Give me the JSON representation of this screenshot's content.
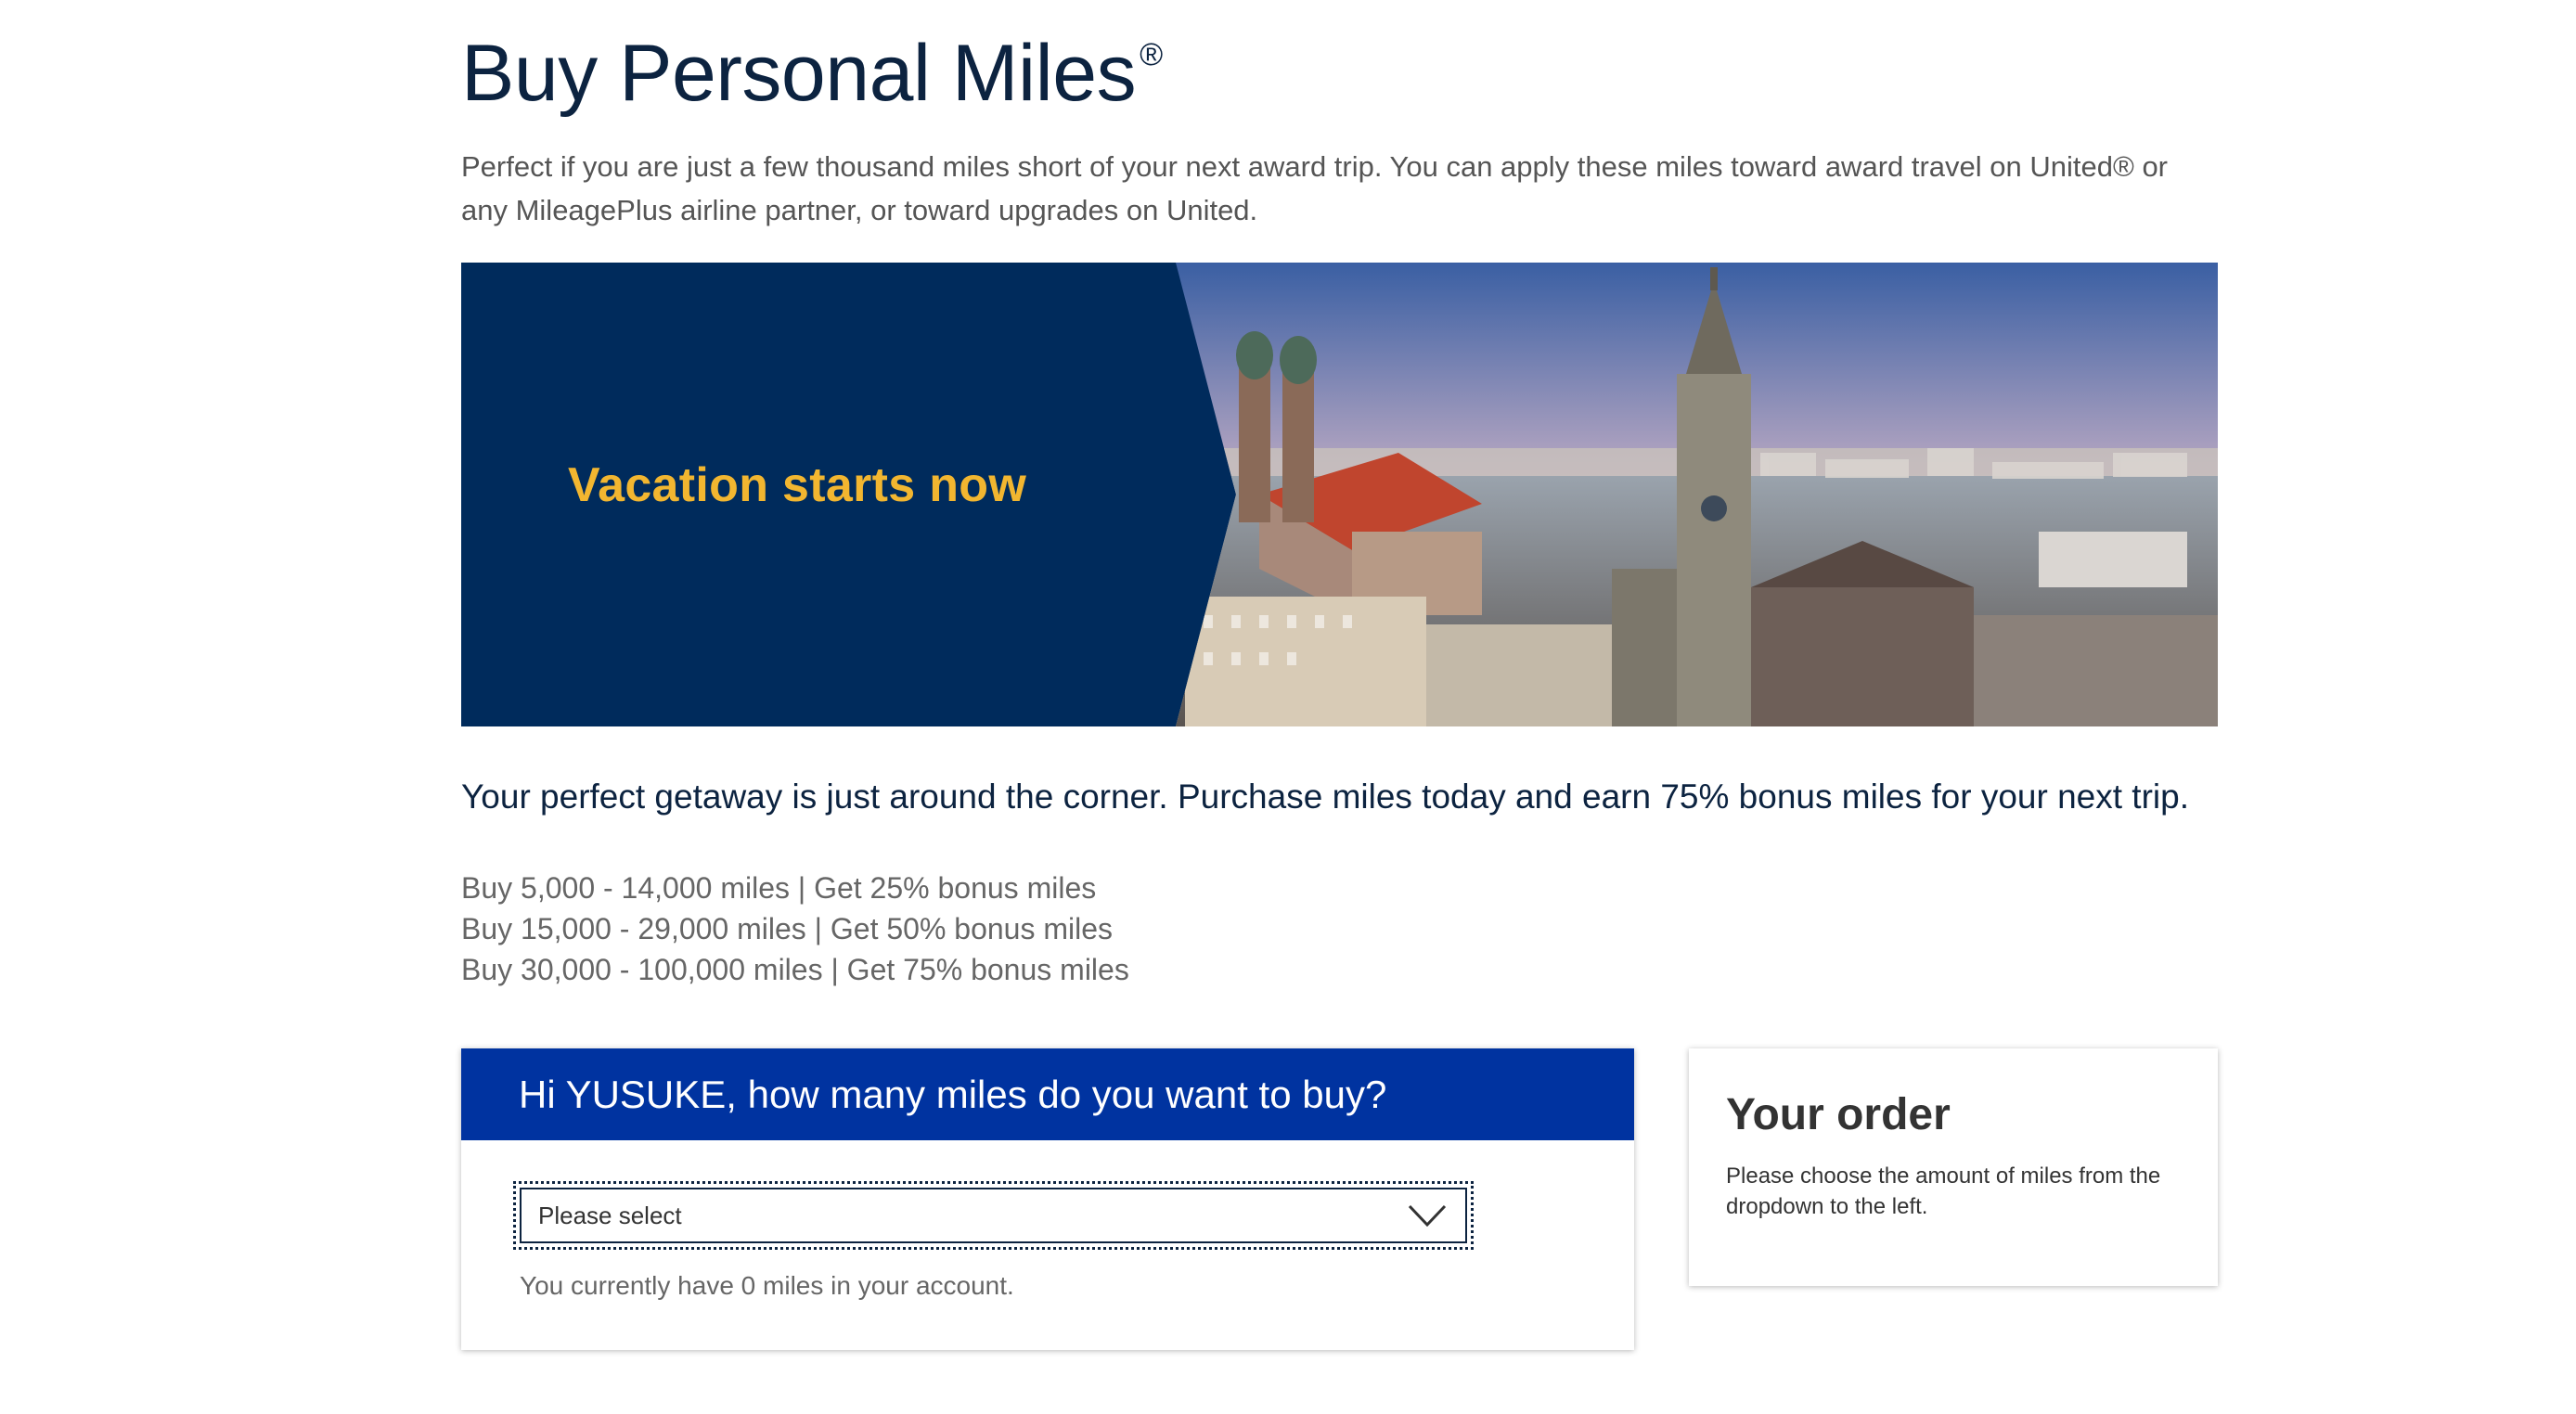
{
  "page": {
    "title": "Buy Personal Miles",
    "title_mark": "®",
    "intro": "Perfect if you are just a few thousand miles short of your next award trip. You can apply these miles toward award travel on United® or any MileagePlus airline partner, or toward upgrades on United."
  },
  "banner": {
    "headline": "Vacation starts now",
    "image_subject": "city skyline with cathedral towers at sunset",
    "colors": {
      "panel": "#002b5c",
      "headline": "#f2b630"
    }
  },
  "promo": {
    "text": "Your perfect getaway is just around the corner. Purchase miles today and earn 75% bonus miles for your next trip."
  },
  "tiers": [
    "Buy 5,000 - 14,000 miles | Get 25% bonus miles",
    "Buy 15,000 - 29,000 miles | Get 50% bonus miles",
    "Buy 30,000 - 100,000 miles | Get 75% bonus miles"
  ],
  "buy": {
    "header": "Hi YUSUKE, how many miles do you want to buy?",
    "select_value": "Please select",
    "balance_text": "You currently have 0 miles in your account.",
    "header_color": "#0033a0"
  },
  "order": {
    "title": "Your order",
    "text": "Please choose the amount of miles from the dropdown to the left."
  }
}
